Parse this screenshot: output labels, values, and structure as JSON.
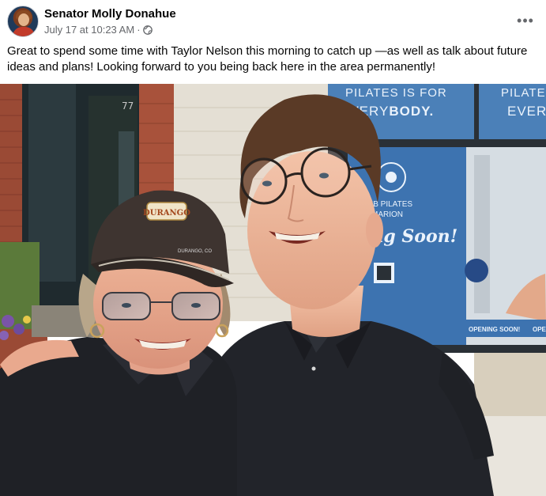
{
  "post": {
    "author": "Senator Molly Donahue",
    "timestamp": "July 17 at 10:23 AM",
    "separator": "·",
    "more_label": "•••",
    "text": "Great to spend some time with Taylor Nelson this morning to catch up —as well as talk about future ideas and plans! Looking forward to you being back here in the area permanently!"
  },
  "photo": {
    "building_number": "77",
    "sign_top_line1": "PILATES IS FOR",
    "sign_top_line2_a": "EVERY",
    "sign_top_line2_b": "BODY.",
    "sign_right_1": "PILATE",
    "sign_right_2": "EVER",
    "club_line1": "UB PILATES",
    "club_line2": "MARION",
    "coming_soon": "ning Soon!",
    "opening_soon": "OPENING SOON!",
    "opening_soon_2": "OPE",
    "cap_text": "DURANGO",
    "cap_brim_text": "DURANGO, CO"
  },
  "colors": {
    "sign_blue": "#3b6ea8",
    "shirt_black": "#1c1d21",
    "brick": "#9a4a35"
  }
}
